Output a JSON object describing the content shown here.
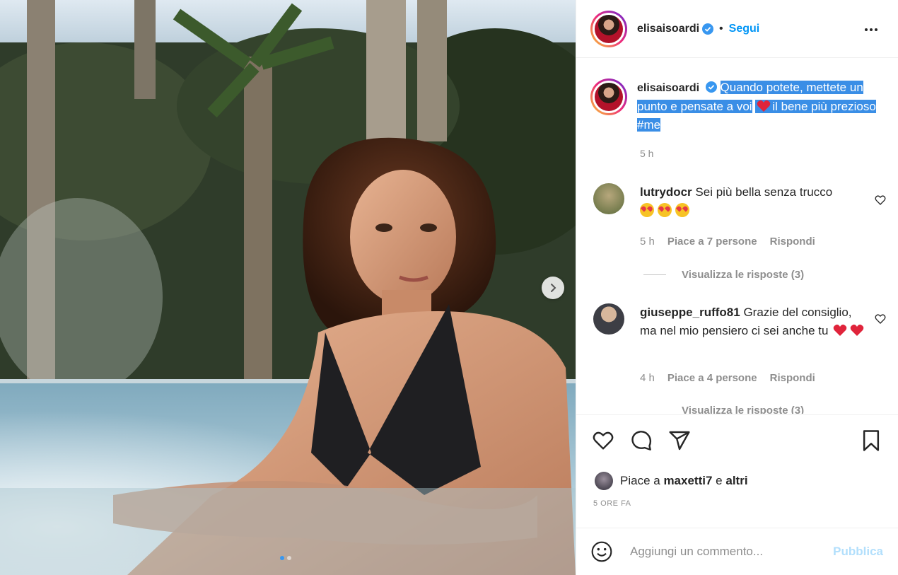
{
  "post": {
    "username": "elisaisoardi",
    "verified": true,
    "follow_label": "Segui",
    "bullet": "•",
    "caption_text": "Quando potete, mettete un punto e pensate a voi",
    "caption_emoji": "red-heart-emoji",
    "caption_text_after": "il bene più prezioso #me",
    "caption_time": "5 h"
  },
  "comments": [
    {
      "username": "lutrydocr",
      "text": "Sei più bella senza trucco",
      "emoji": "heart-eyes-emoji ×3",
      "time": "5 h",
      "likes": "Piace a 7 persone",
      "reply": "Rispondi",
      "view_replies": "Visualizza le risposte (3)"
    },
    {
      "username": "giuseppe_ruffo81",
      "text": "Grazie del consiglio, ma nel mio pensiero ci sei anche tu",
      "emoji": "red-heart-emoji ×2",
      "time": "4 h",
      "likes": "Piace a 4 persone",
      "reply": "Rispondi",
      "view_replies": "Visualizza le risposte (3)"
    }
  ],
  "likes_summary": {
    "prefix": "Piace a",
    "user": "maxetti7",
    "joiner": "e",
    "others": "altri"
  },
  "post_date": "5 ORE FA",
  "add_comment": {
    "placeholder": "Aggiungi un commento...",
    "publish_label": "Pubblica"
  },
  "carousel": {
    "current": 1,
    "total": 2
  },
  "colors": {
    "accent": "#0095f6",
    "selection": "#3a8ee6",
    "muted": "#8e8e8e",
    "publish_disabled": "#b2dffc"
  }
}
